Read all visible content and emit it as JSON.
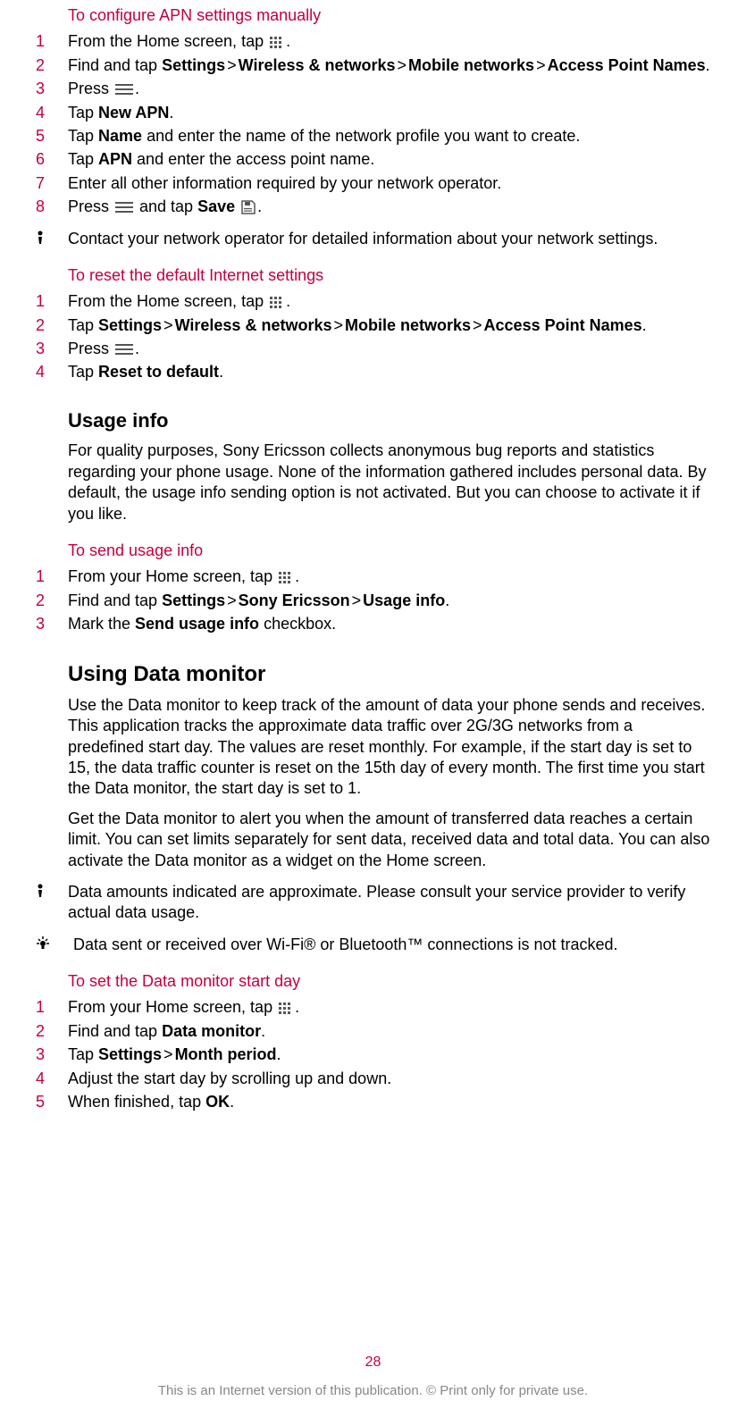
{
  "sec1": {
    "title": "To configure APN settings manually",
    "steps": {
      "s1a": "From the Home screen, tap ",
      "s1c": ".",
      "s2a": "Find and tap ",
      "s2_settings": "Settings",
      "s2_wn": "Wireless & networks",
      "s2_mn": "Mobile networks",
      "s2_apn": "Access Point Names",
      "s2z": ".",
      "s3a": "Press ",
      "s3c": ".",
      "s4a": "Tap ",
      "s4b": "New APN",
      "s4c": ".",
      "s5a": "Tap ",
      "s5b": "Name",
      "s5c": " and enter the name of the network profile you want to create.",
      "s6a": "Tap ",
      "s6b": "APN",
      "s6c": " and enter the access point name.",
      "s7": "Enter all other information required by your network operator.",
      "s8a": "Press ",
      "s8b": " and tap ",
      "s8c": "Save ",
      "s8d": "."
    },
    "note": "Contact your network operator for detailed information about your network settings."
  },
  "sec2": {
    "title": "To reset the default Internet settings",
    "steps": {
      "s1a": "From the Home screen, tap ",
      "s1c": ".",
      "s2a": "Tap ",
      "s2_settings": "Settings",
      "s2_wn": "Wireless & networks",
      "s2_mn": "Mobile networks",
      "s2_apn": "Access Point Names",
      "s2z": ".",
      "s3a": "Press ",
      "s3c": ".",
      "s4a": "Tap ",
      "s4b": "Reset to default",
      "s4c": "."
    }
  },
  "usage": {
    "title": "Usage info",
    "para": "For quality purposes, Sony Ericsson collects anonymous bug reports and statistics regarding your phone usage. None of the information gathered includes personal data. By default, the usage info sending option is not activated. But you can choose to activate it if you like."
  },
  "sec3": {
    "title": "To send usage info",
    "steps": {
      "s1a": "From your Home screen, tap ",
      "s1c": ".",
      "s2a": "Find and tap ",
      "s2_settings": "Settings",
      "s2_se": "Sony Ericsson",
      "s2_ui": "Usage info",
      "s2z": ".",
      "s3a": "Mark the ",
      "s3b": "Send usage info",
      "s3c": " checkbox."
    }
  },
  "datamon": {
    "title": "Using Data monitor",
    "para1": "Use the Data monitor to keep track of the amount of data your phone sends and receives. This application tracks the approximate data traffic over 2G/3G networks from a predefined start day. The values are reset monthly. For example, if the start day is set to 15, the data traffic counter is reset on the 15th day of every month. The first time you start the Data monitor, the start day is set to 1.",
    "para2": "Get the Data monitor to alert you when the amount of transferred data reaches a certain limit. You can set limits separately for sent data, received data and total data. You can also activate the Data monitor as a widget on the Home screen.",
    "note1": "Data amounts indicated are approximate. Please consult your service provider to verify actual data usage.",
    "note2": "Data sent or received over Wi-Fi® or Bluetooth™ connections is not tracked."
  },
  "sec4": {
    "title": "To set the Data monitor start day",
    "steps": {
      "s1a": "From your Home screen, tap ",
      "s1c": ".",
      "s2a": "Find and tap ",
      "s2b": "Data monitor",
      "s2c": ".",
      "s3a": "Tap ",
      "s3_settings": "Settings",
      "s3_mp": "Month period",
      "s3z": ".",
      "s4": "Adjust the start day by scrolling up and down.",
      "s5a": "When finished, tap ",
      "s5b": "OK",
      "s5c": "."
    }
  },
  "nums": {
    "n1": "1",
    "n2": "2",
    "n3": "3",
    "n4": "4",
    "n5": "5",
    "n6": "6",
    "n7": "7",
    "n8": "8"
  },
  "gt": ">",
  "page_number": "28",
  "footer": "This is an Internet version of this publication. © Print only for private use."
}
